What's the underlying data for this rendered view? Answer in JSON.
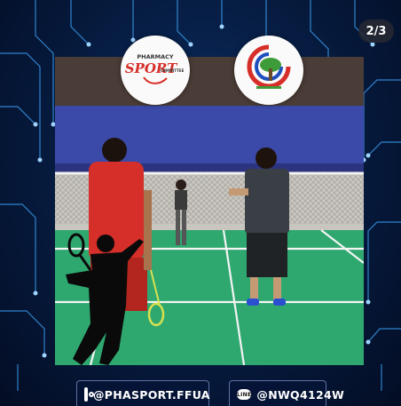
{
  "post": {
    "counter": "2/3",
    "social": {
      "instagram_handle": "@PHASPORT.FFUA",
      "line_handle": "@NWQ4124W",
      "line_badge": "LINE"
    },
    "logos": {
      "left_text_top": "PHARMACY",
      "left_text_main": "SPORT",
      "left_text_sub": "COMMITTEE"
    },
    "colors": {
      "background": "#051637",
      "circuit": "#3fa9ff",
      "court": "#2fa870",
      "wall_blue": "#3b4aa8"
    }
  }
}
